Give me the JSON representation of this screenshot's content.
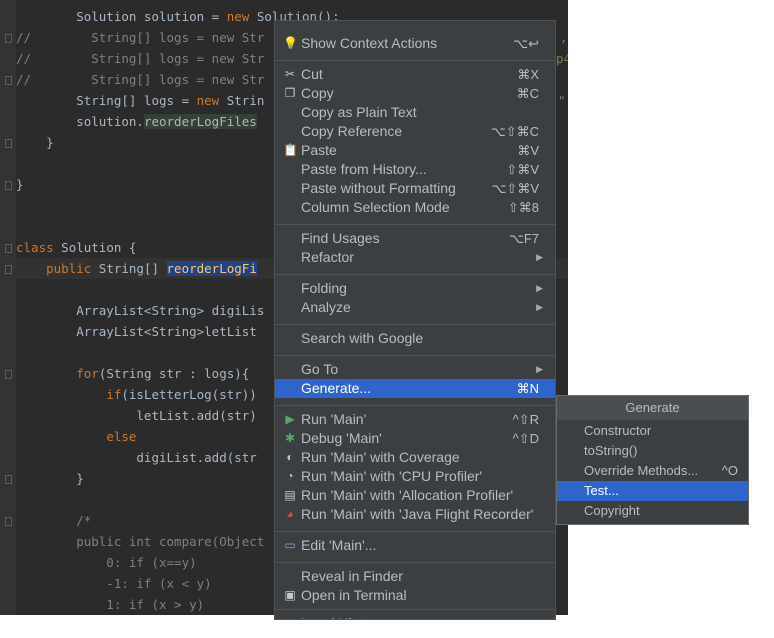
{
  "editor": {
    "lines": [
      "        Solution solution = new Solution();",
      "//        String[] logs = new Str",
      "//        String[] logs = new Str",
      "//        String[] logs = new Str",
      "        String[] logs = new Strin",
      "        solution.reorderLogFiles",
      "    }",
      "",
      "}",
      "",
      "",
      "class Solution {",
      "    public String[] reorderLogFi",
      "",
      "        ArrayList<String> digiLis",
      "        ArrayList<String>letList",
      "",
      "        for(String str : logs){",
      "            if(isLetterLog(str))",
      "                letList.add(str)",
      "            else",
      "                digiList.add(str",
      "        }",
      "",
      "        /*",
      "        public int compare(Object",
      "            0: if (x==y)",
      "            -1: if (x < y)",
      "            1: if (x > y)"
    ],
    "peek_right": [
      ",",
      "p4",
      "\""
    ]
  },
  "context_menu": {
    "items": [
      {
        "label": "Show Context Actions",
        "shortcut": "⌥↩",
        "icon": "bulb-icon"
      },
      {
        "label": "Cut",
        "shortcut": "⌘X",
        "icon": "scissors-icon"
      },
      {
        "label": "Copy",
        "shortcut": "⌘C",
        "icon": "copy-icon"
      },
      {
        "label": "Copy as Plain Text",
        "shortcut": ""
      },
      {
        "label": "Copy Reference",
        "shortcut": "⌥⇧⌘C"
      },
      {
        "label": "Paste",
        "shortcut": "⌘V",
        "icon": "clipboard-icon"
      },
      {
        "label": "Paste from History...",
        "shortcut": "⇧⌘V"
      },
      {
        "label": "Paste without Formatting",
        "shortcut": "⌥⇧⌘V"
      },
      {
        "label": "Column Selection Mode",
        "shortcut": "⇧⌘8"
      },
      {
        "label": "Find Usages",
        "shortcut": "⌥F7"
      },
      {
        "label": "Refactor",
        "submenu": true
      },
      {
        "label": "Folding",
        "submenu": true
      },
      {
        "label": "Analyze",
        "submenu": true
      },
      {
        "label": "Search with Google",
        "shortcut": ""
      },
      {
        "label": "Go To",
        "submenu": true
      },
      {
        "label": "Generate...",
        "shortcut": "⌘N",
        "highlighted": true
      },
      {
        "label": "Run 'Main'",
        "shortcut": "^⇧R",
        "icon": "run-icon"
      },
      {
        "label": "Debug 'Main'",
        "shortcut": "^⇧D",
        "icon": "debug-icon"
      },
      {
        "label": "Run 'Main' with Coverage",
        "icon": "coverage-icon"
      },
      {
        "label": "Run 'Main' with 'CPU Profiler'",
        "icon": "cpu-profiler-icon"
      },
      {
        "label": "Run 'Main' with 'Allocation Profiler'",
        "icon": "allocation-profiler-icon"
      },
      {
        "label": "Run 'Main' with 'Java Flight Recorder'",
        "icon": "flight-recorder-icon"
      },
      {
        "label": "Edit 'Main'...",
        "icon": "edit-config-icon"
      },
      {
        "label": "Reveal in Finder"
      },
      {
        "label": "Open in Terminal",
        "icon": "terminal-icon"
      },
      {
        "label": "Local History",
        "submenu": true
      }
    ]
  },
  "generate_menu": {
    "title": "Generate",
    "items": [
      {
        "label": "Constructor",
        "shortcut": ""
      },
      {
        "label": "toString()",
        "shortcut": ""
      },
      {
        "label": "Override Methods...",
        "shortcut": "^O"
      },
      {
        "label": "Test...",
        "shortcut": "",
        "highlighted": true
      },
      {
        "label": "Copyright",
        "shortcut": ""
      }
    ]
  },
  "colors": {
    "editor_bg": "#2b2b2b",
    "menu_bg": "#3c3f41",
    "highlight": "#2f65ca",
    "keyword": "#cc7832",
    "comment": "#808080"
  }
}
